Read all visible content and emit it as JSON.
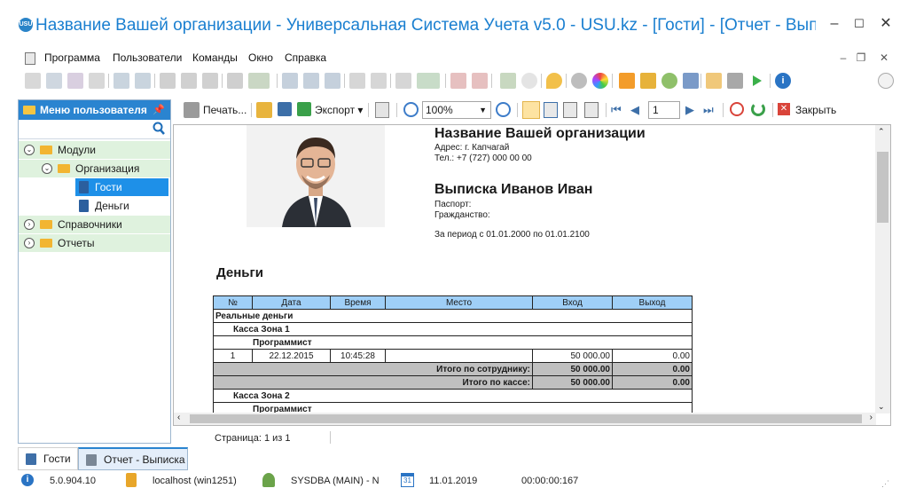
{
  "window": {
    "app_icon_text": "USU",
    "title": "Название Вашей организации - Универсальная Система Учета v5.0 - USU.kz - [Гости] - [Отчет - Вып...",
    "minimize": "–",
    "maximize": "☐",
    "close": "✕"
  },
  "menu": {
    "items": [
      "Программа",
      "Пользователи",
      "Команды",
      "Окно",
      "Справка"
    ]
  },
  "left_panel": {
    "title": "Меню пользователя",
    "tree": [
      {
        "label": "Модули"
      },
      {
        "label": "Организация"
      },
      {
        "label": "Гости"
      },
      {
        "label": "Деньги"
      },
      {
        "label": "Справочники"
      },
      {
        "label": "Отчеты"
      }
    ]
  },
  "report_toolbar": {
    "print_label": "Печать...",
    "export_label": "Экспорт",
    "zoom_value": "100%",
    "page_value": "1",
    "close_label": "Закрыть"
  },
  "report": {
    "org_name": "Название Вашей организации",
    "address": "Адрес: г. Капчагай",
    "phone": "Тел.: +7 (727) 000 00 00",
    "doc_title": "Выписка Иванов Иван",
    "passport": "Паспорт:",
    "citizenship": "Гражданство:",
    "period": "За период с 01.01.2000 по 01.01.2100",
    "section_title": "Деньги",
    "columns": [
      "№",
      "Дата",
      "Время",
      "Место",
      "Вход",
      "Выход"
    ],
    "group_real": "Реальные деньги",
    "kassa1": "Касса Зона 1",
    "programmer": "Программист",
    "row": {
      "n": "1",
      "date": "22.12.2015",
      "time": "10:45:28",
      "place": "",
      "in": "50 000.00",
      "out": "0.00"
    },
    "total_emp_label": "Итого по сотруднику:",
    "total_emp_in": "50 000.00",
    "total_emp_out": "0.00",
    "total_kassa_label": "Итого по кассе:",
    "total_kassa_in": "50 000.00",
    "total_kassa_out": "0.00",
    "kassa2": "Касса Зона 2",
    "programmer2": "Программист"
  },
  "page_status": "Страница: 1 из 1",
  "tabs": [
    "Гости",
    "Отчет - Выписка"
  ],
  "statusbar": {
    "version": "5.0.904.10",
    "server": "localhost (win1251)",
    "user": "SYSDBA (MAIN) - N",
    "date_icon_text": "31",
    "date": "11.01.2019",
    "timer": "00:00:00:167"
  },
  "colors": {
    "accent": "#2a84d0",
    "title_text": "#1a7fd0",
    "table_header": "#9fcff7",
    "total_row": "#c0c0c0",
    "tree_selected": "#1e90e8"
  }
}
